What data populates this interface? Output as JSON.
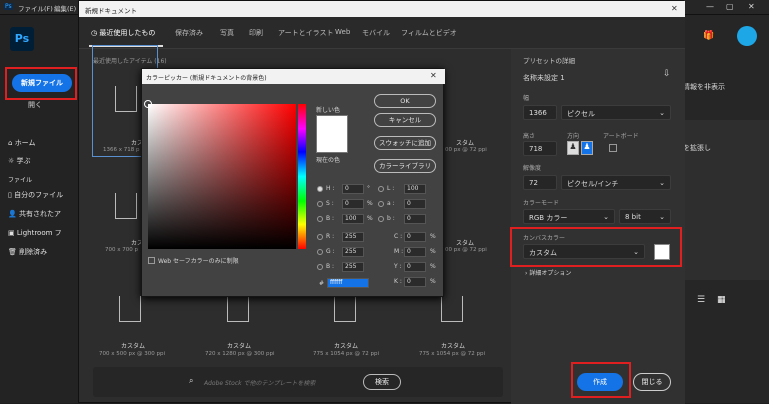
{
  "titlebar": {
    "ps_label": "Ps",
    "menu1": "ファイル(F)",
    "menu2": "編集(E)"
  },
  "sidebar": {
    "new_file": "新規ファイル",
    "open": "開く",
    "section": "ファイル",
    "items": [
      {
        "label": "ホーム"
      },
      {
        "label": "学ぶ"
      },
      {
        "label": "自分のファイル"
      },
      {
        "label": "共有されたア"
      },
      {
        "label": "Lightroom フ"
      },
      {
        "label": "削除済み"
      }
    ]
  },
  "right_ext": {
    "text1": "情報を非表示",
    "text2": "を拡張し"
  },
  "new_doc": {
    "title": "新規ドキュメント",
    "tabs": [
      "最近使用したもの",
      "保存済み",
      "写真",
      "印刷",
      "アートとイラスト",
      "Web",
      "モバイル",
      "フィルムとビデオ"
    ],
    "recent_label": "最近使用したアイテム (16)",
    "items": [
      {
        "name": "カスタ",
        "size": "1366 x 718 p"
      },
      {
        "name": "スタム",
        "size": "00 px @ 72 ppi"
      },
      {
        "name": "カスタ",
        "size": "700 x 700 p"
      },
      {
        "name": "スタム",
        "size": "00 px @ 72 ppi"
      },
      {
        "name": "カスタム",
        "size": "700 x 500 px @ 300 ppi"
      },
      {
        "name": "カスタム",
        "size": "720 x 1280 px @ 300 ppi"
      },
      {
        "name": "カスタム",
        "size": "775 x 1054 px @ 72 ppi"
      },
      {
        "name": "カスタム",
        "size": "775 x 1054 px @ 72 ppi"
      }
    ],
    "search_placeholder": "Adobe Stock で他のテンプレートを検索",
    "search_button": "検索"
  },
  "preset": {
    "heading": "プリセットの詳細",
    "name": "名称未設定 1",
    "width_label": "幅",
    "width": "1366",
    "width_unit": "ピクセル",
    "height_label": "高さ",
    "height": "718",
    "orientation_label": "方向",
    "artboard_label": "アートボード",
    "resolution_label": "解像度",
    "resolution": "72",
    "resolution_unit": "ピクセル/インチ",
    "color_mode_label": "カラーモード",
    "color_mode": "RGB カラー",
    "bit": "8 bit",
    "canvas_label": "カンバスカラー",
    "canvas_value": "カスタム",
    "canvas_swatch": "#ffffff",
    "advanced": "詳細オプション",
    "create": "作成",
    "close": "閉じる"
  },
  "picker": {
    "title": "カラーピッカー (新規ドキュメントの背景色)",
    "new_label": "新しい色",
    "current_label": "現在の色",
    "ok": "OK",
    "cancel": "キャンセル",
    "add_swatch": "スウォッチに追加",
    "libraries": "カラーライブラリ",
    "web_only": "Web セーフカラーのみに制限",
    "H": "0",
    "S": "0",
    "B": "100",
    "R": "255",
    "G": "255",
    "Bb": "255",
    "L": "100",
    "a": "0",
    "b": "0",
    "C": "0",
    "M": "0",
    "Y": "0",
    "K": "0",
    "hex": "ffffff"
  },
  "colors": {
    "accent": "#1473e6",
    "red_highlight": "#e02020"
  }
}
